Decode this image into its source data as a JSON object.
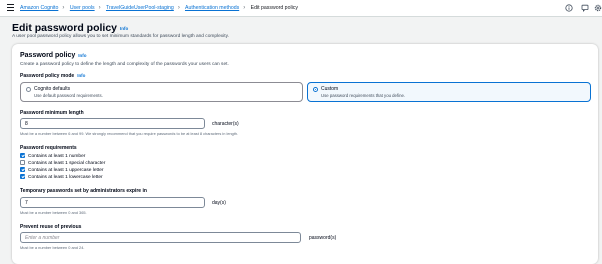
{
  "breadcrumb": [
    "Amazon Cognito",
    "User pools",
    "TravelGuideUserPool-staging",
    "Authentication methods",
    "Edit password policy"
  ],
  "header": {
    "title": "Edit password policy",
    "info": "Info",
    "subtitle": "A user pool password policy allows you to set minimum standards for password length and complexity."
  },
  "panel": {
    "title": "Password policy",
    "info": "Info",
    "description": "Create a password policy to define the length and complexity of the passwords your users can set.",
    "mode": {
      "label": "Password policy mode",
      "info": "Info",
      "options": [
        {
          "name": "Cognito defaults",
          "desc": "Use default password requirements.",
          "selected": false
        },
        {
          "name": "Custom",
          "desc": "Use password requirements that you define.",
          "selected": true
        }
      ]
    },
    "min_length": {
      "label": "Password minimum length",
      "value": "8",
      "unit": "character(s)",
      "hint": "Must be a number between 6 and 99. We strongly recommend that you require passwords to be at least 8 characters in length."
    },
    "requirements": {
      "label": "Password requirements",
      "items": [
        {
          "label": "Contains at least 1 number",
          "checked": true
        },
        {
          "label": "Contains at least 1 special character",
          "checked": false
        },
        {
          "label": "Contains at least 1 uppercase letter",
          "checked": true
        },
        {
          "label": "Contains at least 1 lowercase letter",
          "checked": true
        }
      ]
    },
    "temp_expiry": {
      "label": "Temporary passwords set by administrators expire in",
      "value": "7",
      "unit": "day(s)",
      "hint": "Must be a number between 0 and 365."
    },
    "reuse": {
      "label": "Prevent reuse of previous",
      "placeholder": "Enter a number",
      "unit": "password(s)",
      "hint": "Must be a number between 0 and 24."
    }
  },
  "icons": [
    "menu-icon",
    "info-circle-icon",
    "notifications-icon",
    "settings-icon"
  ],
  "colors": {
    "link": "#0972d3",
    "selected_bg": "#f2f8fd",
    "page_bg": "#f2f3f3"
  }
}
